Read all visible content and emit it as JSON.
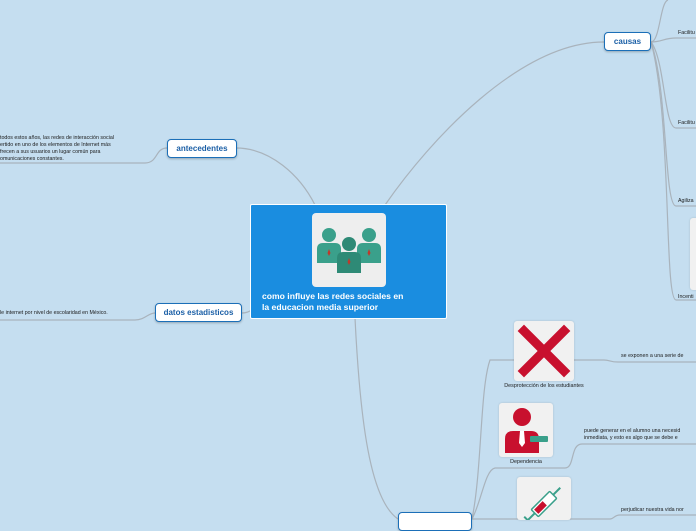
{
  "center": {
    "title_line1": "como influye las redes sociales en",
    "title_line2": "la educacion media superior",
    "icon": "people-group-icon"
  },
  "topics": {
    "antecedentes": "antecedentes",
    "causas": "causas",
    "datos": "datos estadisticos"
  },
  "antecedentes_text": [
    "todos estos años, las redes de interacción social",
    "ertido en uno de los elementos de Internet más",
    "frecen a sus usuarios un lugar común para",
    "omunicaciones constantes."
  ],
  "datos_text": "le internet por nivel de escolaridad en México.",
  "causas_items": [
    "Facilitu",
    "Facilitu",
    "Agiliza",
    "Incenti"
  ],
  "consecuencias": [
    {
      "caption": "Desprotección de los estudiantes",
      "icon": "red-x-icon",
      "text": [
        "se exponen a una serie de"
      ]
    },
    {
      "caption": "Dependencia",
      "icon": "person-red-suit-icon",
      "text": [
        "puede generar en el alumno una necesid",
        "inmediata, y esto es algo que se debe e"
      ]
    },
    {
      "caption": "",
      "icon": "syringe-icon",
      "text": [
        "perjudicar nuestra vida nor"
      ]
    }
  ],
  "colors": {
    "background": "#c5def0",
    "center": "#1a8de0",
    "node_border": "#1b6fb8",
    "link": "#a8b4bf"
  }
}
